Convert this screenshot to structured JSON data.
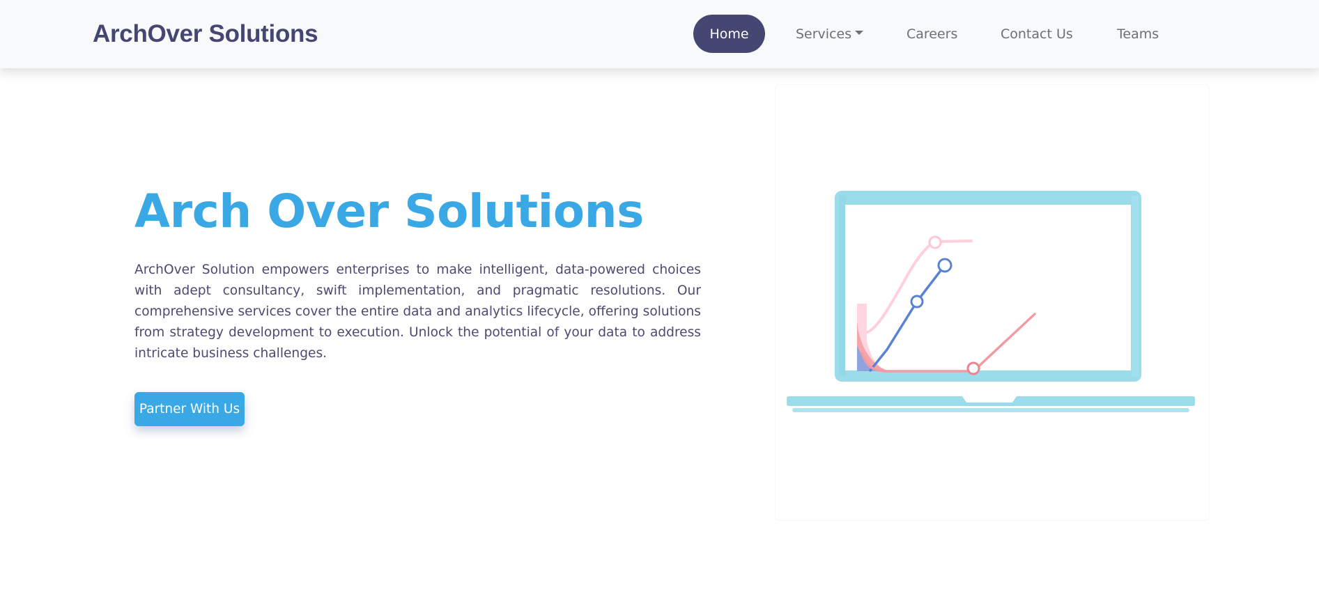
{
  "navbar": {
    "brand": "ArchOver Solutions",
    "items": [
      {
        "label": "Home",
        "active": true
      },
      {
        "label": "Services",
        "has_dropdown": true
      },
      {
        "label": "Careers"
      },
      {
        "label": "Contact Us"
      },
      {
        "label": "Teams"
      }
    ]
  },
  "hero": {
    "title": "Arch Over Solutions",
    "description": "ArchOver Solution empowers enterprises to make intelligent, data-powered choices with adept consultancy, swift implementation, and pragmatic resolutions. Our comprehensive services cover the entire data and analytics lifecycle, offering solutions from strategy development to execution. Unlock the potential of your data to address intricate business challenges.",
    "cta_label": "Partner With Us",
    "illustration_icon": "laptop-analytics-chart-icon"
  },
  "colors": {
    "brand": "#464673",
    "accent": "#3aa8e4",
    "nav_background": "#f8f9fa",
    "nav_text": "#6c6f78",
    "laptop": "#9adcea",
    "chart_pink": "#f6a3aa",
    "chart_blue": "#5a82d2",
    "chart_light_pink": "#ffd0dc"
  }
}
